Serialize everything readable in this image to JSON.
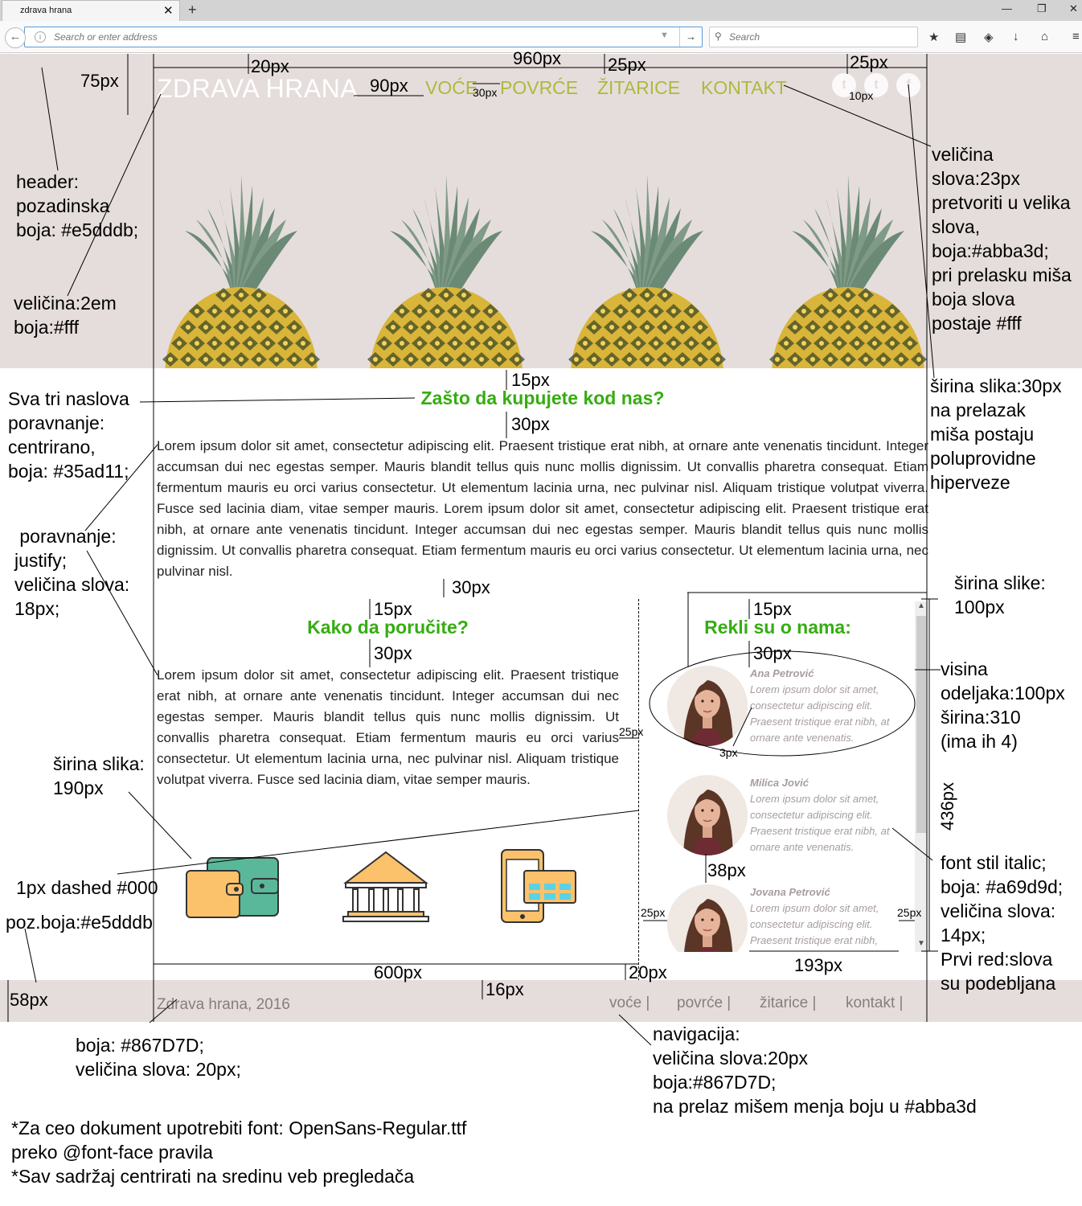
{
  "browser": {
    "tab_title": "zdrava hrana",
    "tab_close": "✕",
    "new_tab": "+",
    "window_buttons": [
      "—",
      "❐",
      "✕"
    ],
    "back_glyph": "←",
    "info_glyph": "i",
    "url_placeholder": "Search or enter address",
    "url_dropdown": "▼",
    "go_glyph": "→",
    "search_glyph": "⚲",
    "search_placeholder": "Search",
    "toolbar_icons": [
      "★",
      "▤",
      "◈",
      "↓",
      "⌂",
      "≡"
    ]
  },
  "site": {
    "logo": "ZDRAVA HRANA",
    "nav": [
      "VOĆE",
      "POVRĆE",
      "ŽITARICE",
      "KONTAKT"
    ],
    "social": [
      "t",
      "t",
      "f"
    ],
    "section1_title": "Zašto da kupujete kod nas?",
    "section1_text": "Lorem ipsum dolor sit amet, consectetur adipiscing elit. Praesent tristique erat nibh, at ornare ante venenatis tincidunt. Integer accumsan dui nec egestas semper. Mauris blandit tellus quis nunc mollis dignissim. Ut convallis pharetra consequat. Etiam fermentum mauris eu orci varius consectetur. Ut elementum lacinia urna, nec pulvinar nisl. Aliquam tristique volutpat viverra. Fusce sed lacinia diam, vitae semper mauris. Lorem ipsum dolor sit amet, consectetur adipiscing elit. Praesent tristique erat nibh, at ornare ante venenatis tincidunt. Integer accumsan dui nec egestas semper. Mauris blandit tellus quis nunc mollis dignissim. Ut convallis pharetra consequat. Etiam fermentum mauris eu orci varius consectetur. Ut elementum lacinia urna, nec pulvinar nisl.",
    "section2_title": "Kako da poručite?",
    "section2_text": "Lorem ipsum dolor sit amet, consectetur adipiscing elit. Praesent tristique erat nibh, at ornare ante venenatis tincidunt. Integer accumsan dui nec egestas semper. Mauris blandit tellus quis nunc mollis dignissim. Ut convallis pharetra consequat. Etiam fermentum mauris eu orci varius consectetur. Ut elementum lacinia urna, nec pulvinar nisl. Aliquam tristique volutpat viverra. Fusce sed lacinia diam, vitae semper mauris.",
    "section3_title": "Rekli su o nama:",
    "testimonials": [
      {
        "name": "Ana Petrović",
        "text": "Lorem ipsum dolor sit amet, consectetur adipiscing elit. Praesent tristique erat nibh, at ornare ante venenatis."
      },
      {
        "name": "Milica Jović",
        "text": "Lorem ipsum dolor sit amet, consectetur adipiscing elit. Praesent tristique erat nibh, at ornare ante venenatis."
      },
      {
        "name": "Jovana Petrović",
        "text": "Lorem ipsum dolor sit amet, consectetur adipiscing elit. Praesent tristique erat nibh,"
      }
    ],
    "scroll_up": "▲",
    "scroll_down": "▼",
    "footer_copy": "Zdrava hrana, 2016",
    "footer_nav": [
      "voće |",
      "povrće |",
      "žitarice |",
      "kontakt |"
    ],
    "colors": {
      "header_bg": "#e5dddb",
      "nav": "#abba3d",
      "title": "#35ad11",
      "testimonial": "#a69d9d",
      "footer_text": "#867D7D"
    },
    "icons": [
      "wallet-icon",
      "bank-icon",
      "mobile-payment-icon",
      "twitter-icon",
      "tumblr-icon",
      "facebook-icon"
    ]
  },
  "annotations": {
    "dims": {
      "d960": "960px",
      "d20": "20px",
      "d25a": "25px",
      "d25b": "25px",
      "d75": "75px",
      "d90": "90px",
      "d30small": "30px",
      "d10": "10px",
      "d15a": "15px",
      "d30a": "30px",
      "d30b": "30px",
      "d15b": "15px",
      "d30c": "30px",
      "d15c": "15px",
      "d30d": "30px",
      "d3": "3px",
      "d38": "38px",
      "d25c": "25px",
      "d25d": "25px",
      "d25e": "25px",
      "d193": "193px",
      "d600": "600px",
      "d20b": "20px",
      "d16": "16px",
      "d58": "58px",
      "d436": "436px"
    },
    "header_note": [
      "header:",
      "pozadinska",
      "boja: #e5dddb;"
    ],
    "logo_note": [
      "veličina:2em",
      "boja:#fff"
    ],
    "titles_note": [
      "Sva tri naslova",
      "poravnanje:",
      "centrirano,",
      "boja: #35ad11;"
    ],
    "text_note": [
      " poravnanje:",
      "justify;",
      "veličina slova:",
      "18px;"
    ],
    "img_note": [
      "širina slika:",
      "190px"
    ],
    "dashed_note": "1px dashed #000",
    "footer_bg_note": "poz.boja:#e5dddb",
    "nav_note": [
      "veličina",
      "slova:23px",
      "pretvoriti u velika",
      "slova,",
      "boja:#abba3d;",
      "pri prelasku miša",
      "boja slova",
      "postaje #fff"
    ],
    "social_note": [
      "širina slika:30px",
      "na prelazak",
      "miša  postaju",
      "poluprovidne",
      "hiperveze"
    ],
    "avatar_note": [
      "širina slike:",
      "100px"
    ],
    "row_note": [
      "visina",
      "odeljaka:100px",
      "širina:310",
      "(ima ih 4)"
    ],
    "italic_note": [
      "font stil italic;",
      "boja: #a69d9d;",
      "veličina slova:",
      "14px;",
      "Prvi red:slova",
      "su podebljana"
    ],
    "footer_copy_note": [
      "boja: #867D7D;",
      "veličina slova: 20px;"
    ],
    "footer_nav_note": [
      "navigacija:",
      "veličina slova:20px",
      "boja:#867D7D;",
      "na prelaz mišem menja boju u #abba3d"
    ],
    "bottom_note": [
      "*Za ceo dokument upotrebiti font: OpenSans-Regular.ttf",
      "preko @font-face pravila",
      "*Sav sadržaj centrirati na sredinu veb pregledača"
    ]
  }
}
